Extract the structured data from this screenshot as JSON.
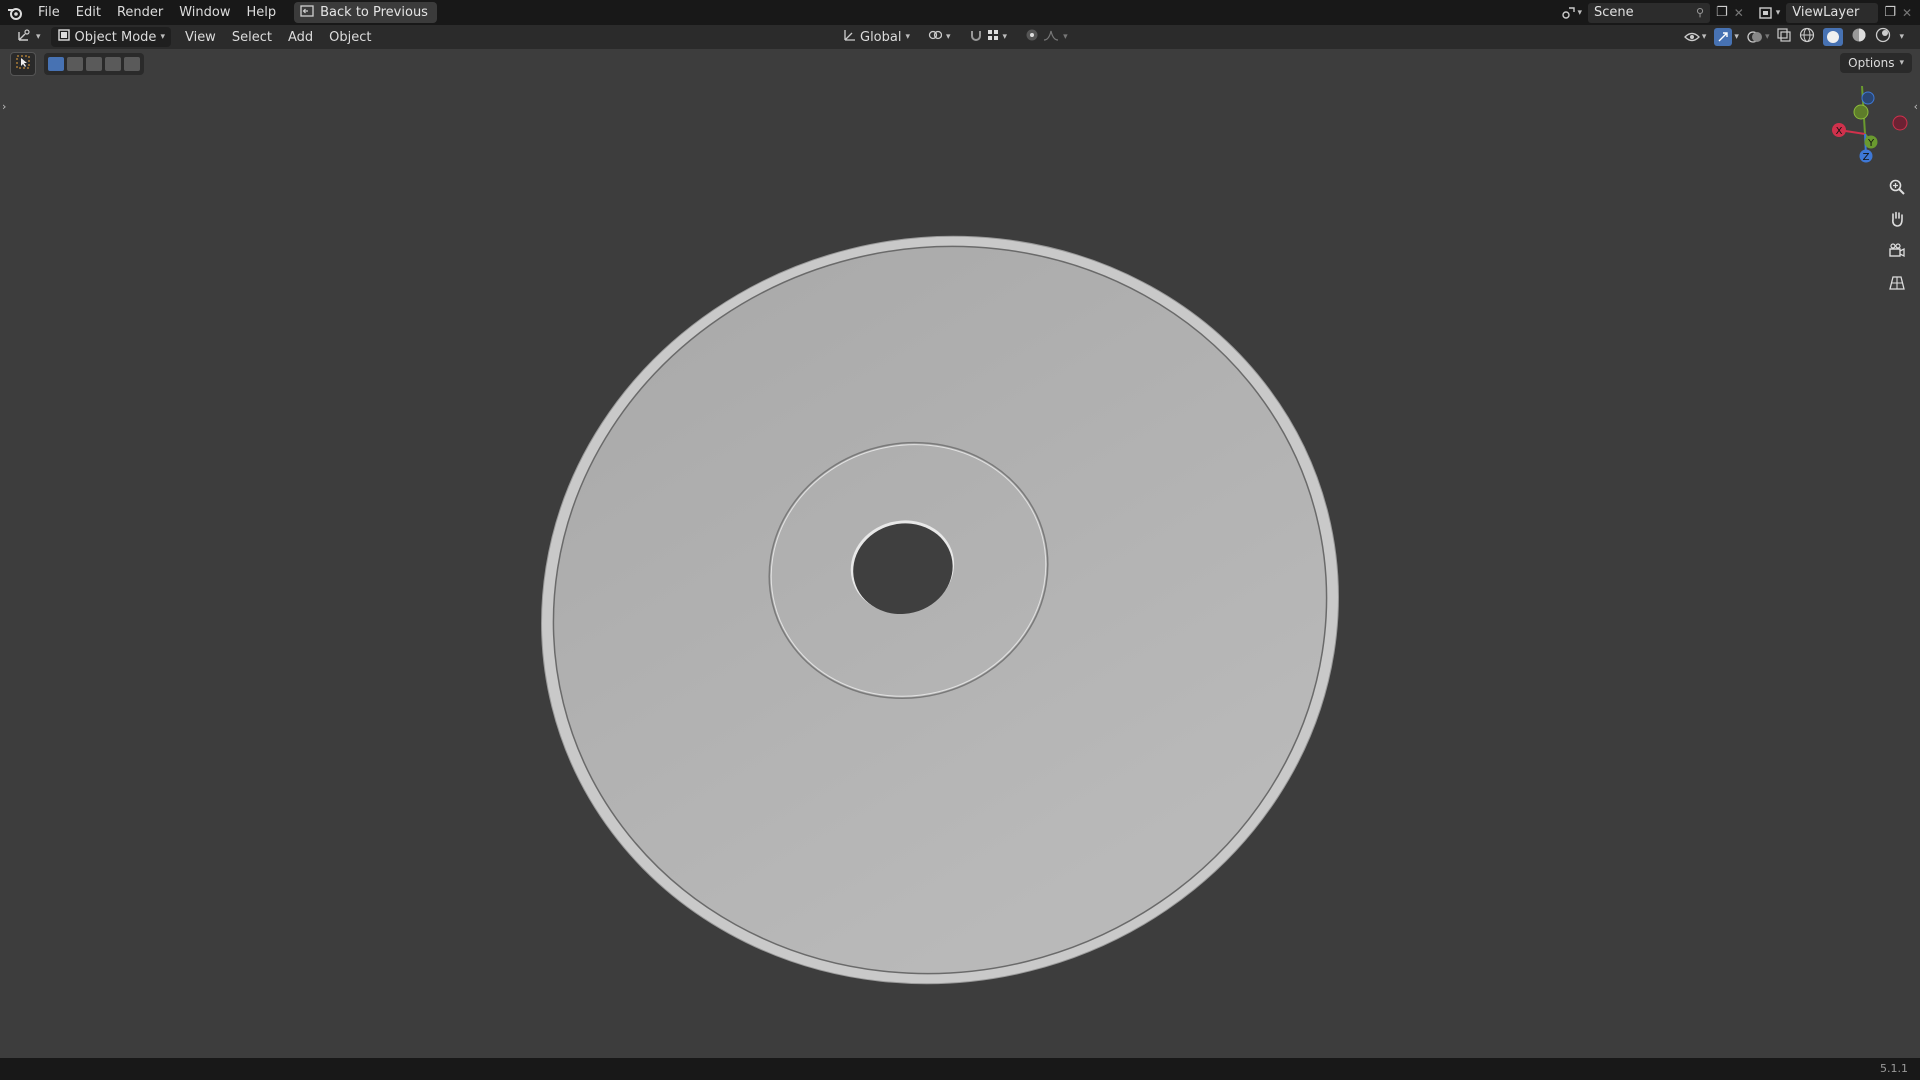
{
  "topbar": {
    "menu": [
      "File",
      "Edit",
      "Render",
      "Window",
      "Help"
    ],
    "back_label": "Back to Previous",
    "scene": "Scene",
    "view_layer": "ViewLayer"
  },
  "header": {
    "mode": "Object Mode",
    "menus": [
      "View",
      "Select",
      "Add",
      "Object"
    ],
    "orientation": "Global"
  },
  "viewport": {
    "options_label": "Options",
    "gizmo": {
      "x": "X",
      "y": "Y",
      "z": "Z"
    },
    "object": "disc"
  },
  "status": {
    "version": "5.1.1"
  },
  "colors": {
    "accent": "#4772b3",
    "x_axis": "#d0314c",
    "y_axis": "#6a9a2f",
    "z_axis": "#3e78d6"
  }
}
